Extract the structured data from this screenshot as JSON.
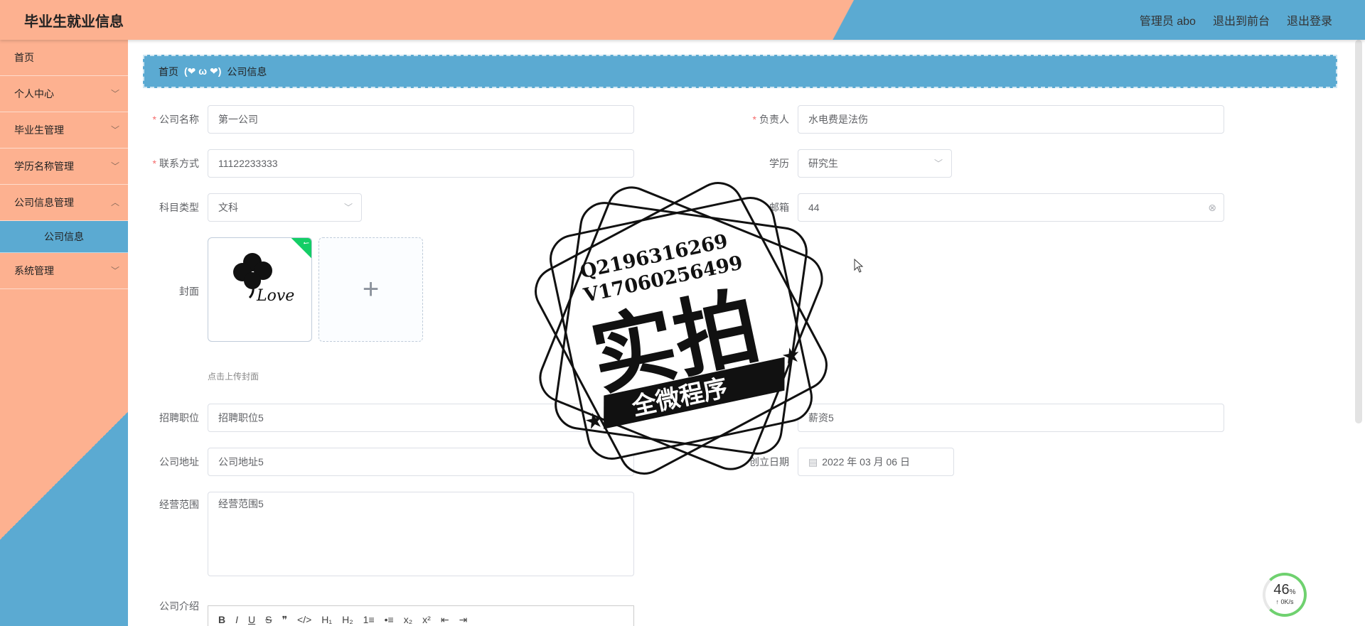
{
  "header": {
    "title": "毕业生就业信息",
    "user": "管理员 abo",
    "to_front": "退出到前台",
    "logout": "退出登录"
  },
  "sidebar": {
    "items": [
      {
        "label": "首页"
      },
      {
        "label": "个人中心"
      },
      {
        "label": "毕业生管理"
      },
      {
        "label": "学历名称管理"
      },
      {
        "label": "公司信息管理"
      }
    ],
    "sub_item": "公司信息",
    "last_item": "系统管理"
  },
  "breadcrumb": {
    "home": "首页",
    "sep": "(❤ ω ❤)",
    "current": "公司信息"
  },
  "form": {
    "company_name_label": "公司名称",
    "company_name": "第一公司",
    "manager_label": "负责人",
    "manager": "水电费是法伤",
    "contact_label": "联系方式",
    "contact": "11122233333",
    "education_label": "学历",
    "education": "研究生",
    "subject_label": "科目类型",
    "subject": "文科",
    "email_label": "邮箱",
    "email": "44",
    "cover_label": "封面",
    "cover_tip": "点击上传封面",
    "position_label": "招聘职位",
    "position": "招聘职位5",
    "salary_label": "薪资",
    "salary": "薪资5",
    "address_label": "公司地址",
    "address": "公司地址5",
    "founded_label": "创立日期",
    "founded": "2022 年 03 月 06 日",
    "scope_label": "经营范围",
    "scope": "经营范围5",
    "intro_label": "公司介绍"
  },
  "editor_toolbar": [
    "B",
    "I",
    "U",
    "S",
    "❞",
    "</>",
    "H₁",
    "H₂",
    "1≡",
    "•≡",
    "x₂",
    "x²",
    "⇤",
    "⇥"
  ],
  "watermark": {
    "line1": "Q2196316269",
    "line2": "V17060256499",
    "big": "实拍",
    "ribbon": "全微程序"
  },
  "cover_image_text": "Love",
  "network": {
    "percent": "46",
    "percent_sign": "%",
    "speed": "↑ 0K/s"
  },
  "colors": {
    "peach": "#fdb190",
    "blue": "#5baad2",
    "required": "#f56c6c"
  }
}
